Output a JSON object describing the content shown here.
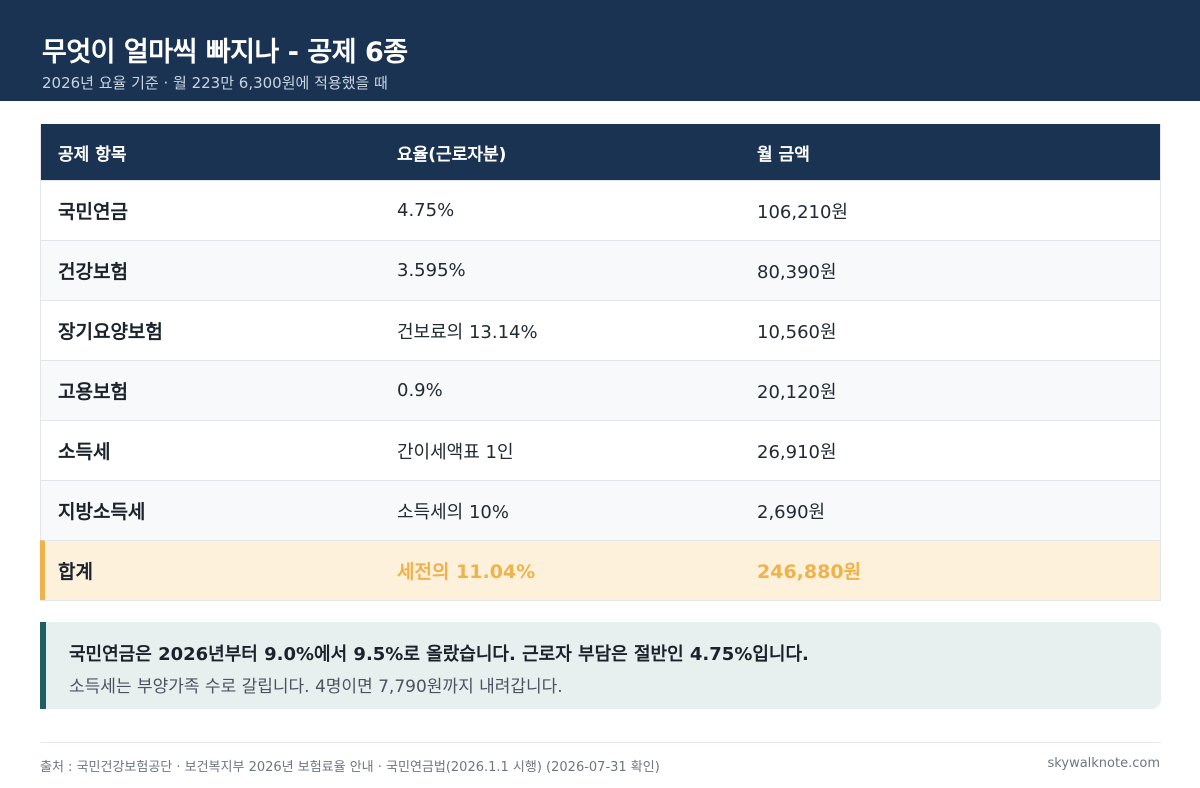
{
  "header": {
    "title": "무엇이 얼마씩 빠지나 - 공제 6종",
    "subtitle": "2026년 요율 기준 · 월 223만 6,300원에 적용했을 때"
  },
  "table": {
    "columns": [
      "공제 항목",
      "요율(근로자분)",
      "월 금액"
    ],
    "rows": [
      {
        "name": "국민연금",
        "rate": "4.75%",
        "amount": "106,210원"
      },
      {
        "name": "건강보험",
        "rate": "3.595%",
        "amount": "80,390원"
      },
      {
        "name": "장기요양보험",
        "rate": "건보료의 13.14%",
        "amount": "10,560원"
      },
      {
        "name": "고용보험",
        "rate": "0.9%",
        "amount": "20,120원"
      },
      {
        "name": "소득세",
        "rate": "간이세액표 1인",
        "amount": "26,910원"
      },
      {
        "name": "지방소득세",
        "rate": "소득세의 10%",
        "amount": "2,690원"
      }
    ],
    "total": {
      "name": "합계",
      "rate": "세전의 11.04%",
      "amount": "246,880원"
    }
  },
  "note": {
    "line1": "국민연금은 2026년부터 9.0%에서 9.5%로 올랐습니다. 근로자 부담은 절반인 4.75%입니다.",
    "line2": "소득세는 부양가족 수로 갈립니다. 4명이면 7,790원까지 내려갑니다."
  },
  "footer": {
    "source": "출처 : 국민건강보험공단 · 보건복지부 2026년 보험료율 안내 · 국민연금법(2026.1.1 시행) (2026-07-31 확인)",
    "brand": "skywalknote.com"
  },
  "colors": {
    "header_bg": "#1b3352",
    "highlight": "#f0b24a",
    "total_bg": "#fdf1dc",
    "note_accent": "#1f5e61",
    "note_bg": "#e8f0ef"
  }
}
